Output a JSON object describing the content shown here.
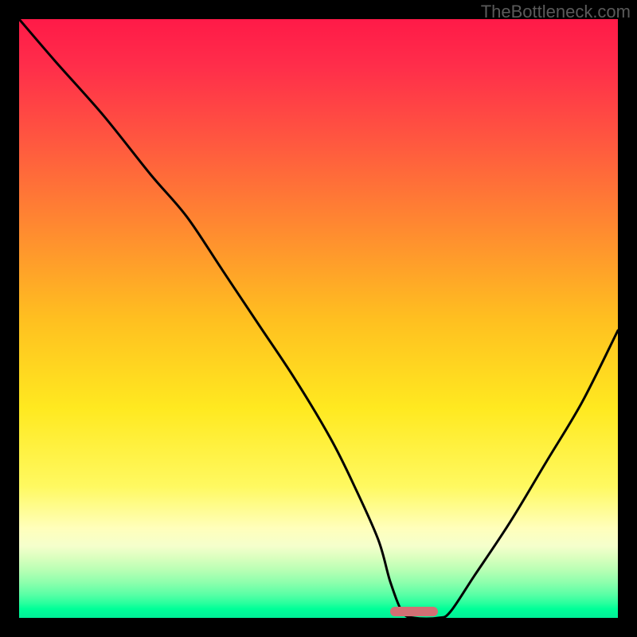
{
  "watermark": "TheBottleneck.com",
  "chart_data": {
    "type": "line",
    "title": "",
    "xlabel": "",
    "ylabel": "",
    "xlim": [
      0,
      100
    ],
    "ylim": [
      0,
      100
    ],
    "grid": false,
    "optimal_marker": {
      "x_center": 66,
      "width_pct": 8
    },
    "series": [
      {
        "name": "bottleneck-curve",
        "x": [
          0,
          6,
          14,
          22,
          28,
          34,
          40,
          46,
          52,
          56,
          60,
          62,
          64,
          66,
          70,
          72,
          76,
          82,
          88,
          94,
          100
        ],
        "values": [
          100,
          93,
          84,
          74,
          67,
          58,
          49,
          40,
          30,
          22,
          13,
          6,
          1,
          0,
          0,
          1,
          7,
          16,
          26,
          36,
          48
        ]
      }
    ],
    "background_gradient": {
      "top_color": "#ff1a48",
      "mid_color": "#ffe920",
      "bottom_color": "#00ee97"
    }
  }
}
